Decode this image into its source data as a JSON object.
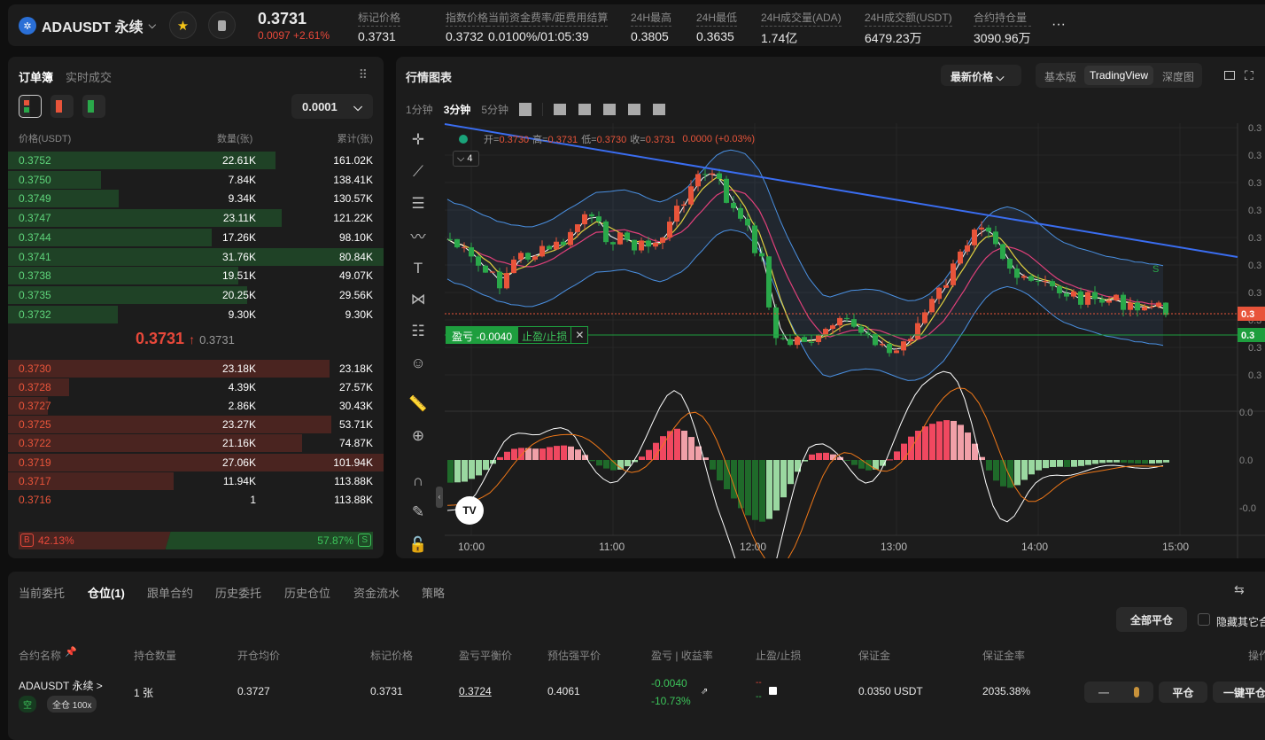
{
  "header": {
    "symbol": "ADAUSDT 永续",
    "coin_icon": "cardano-icon",
    "last_price": "0.3731",
    "change": "0.0097 +2.61%",
    "stats": [
      {
        "label": "标记价格",
        "value": "0.3731"
      },
      {
        "label": "指数价格",
        "value": "0.3732"
      },
      {
        "label": "当前资金费率/距费用结算",
        "value": "0.0100%/01:05:39"
      },
      {
        "label": "24H最高",
        "value": "0.3805"
      },
      {
        "label": "24H最低",
        "value": "0.3635"
      },
      {
        "label": "24H成交量(ADA)",
        "value": "1.74亿"
      },
      {
        "label": "24H成交额(USDT)",
        "value": "6479.23万"
      },
      {
        "label": "合约持仓量",
        "value": "3090.96万"
      }
    ],
    "more": "···"
  },
  "orderbook": {
    "tabs": [
      "订单簿",
      "实时成交"
    ],
    "precision": "0.0001",
    "headers": [
      "价格(USDT)",
      "数量(张)",
      "累计(张)"
    ],
    "top_rows": [
      [
        "0.3752",
        "22.61K",
        "161.02K"
      ],
      [
        "0.3750",
        "7.84K",
        "138.41K"
      ],
      [
        "0.3749",
        "9.34K",
        "130.57K"
      ],
      [
        "0.3747",
        "23.11K",
        "121.22K"
      ],
      [
        "0.3744",
        "17.26K",
        "98.10K"
      ],
      [
        "0.3741",
        "31.76K",
        "80.84K"
      ],
      [
        "0.3738",
        "19.51K",
        "49.07K"
      ],
      [
        "0.3735",
        "20.25K",
        "29.56K"
      ],
      [
        "0.3732",
        "9.30K",
        "9.30K"
      ]
    ],
    "mid_price": "0.3731",
    "mid_arrow": "↑",
    "mark_price": "0.3731",
    "bottom_rows": [
      [
        "0.3730",
        "23.18K",
        "23.18K"
      ],
      [
        "0.3728",
        "4.39K",
        "27.57K"
      ],
      [
        "0.3727",
        "2.86K",
        "30.43K"
      ],
      [
        "0.3725",
        "23.27K",
        "53.71K"
      ],
      [
        "0.3722",
        "21.16K",
        "74.87K"
      ],
      [
        "0.3719",
        "27.06K",
        "101.94K"
      ],
      [
        "0.3717",
        "11.94K",
        "113.88K"
      ],
      [
        "0.3716",
        "1",
        "113.88K"
      ]
    ],
    "buy_label": "B",
    "buy_ratio": "42.13%",
    "sell_ratio": "57.87%",
    "sell_label": "S",
    "buy_fraction": 0.4213
  },
  "chart": {
    "title": "行情图表",
    "price_type": "最新价格",
    "views": [
      "基本版",
      "TradingView",
      "深度图"
    ],
    "active_view": "TradingView",
    "intervals": [
      "1分钟",
      "3分钟",
      "5分钟"
    ],
    "active_interval": "3分钟",
    "ohlc": {
      "o_label": "开=",
      "o": "0.3730",
      "h_label": "高=",
      "h": "0.3731",
      "l_label": "低=",
      "l": "0.3730",
      "c_label": "收=",
      "c": "0.3731",
      "chg": "0.0000 (+0.03%)"
    },
    "indicator_count": "4",
    "pnl_label": "盈亏 -0.0040",
    "tpsl_label": "止盈/止损",
    "close_x": "✕",
    "y_ticks": [
      "0.3",
      "0.3",
      "0.3",
      "0.3",
      "0.3",
      "0.3",
      "0.3",
      "0.3",
      "0.3",
      "0.3"
    ],
    "price_tag": "0.3",
    "position_tag": "0.3",
    "macd_ticks": [
      "0.0",
      "0.0",
      "-0.0"
    ],
    "x_ticks": [
      "10:00",
      "11:00",
      "12:00",
      "13:00",
      "14:00",
      "15:00"
    ],
    "marker": "S",
    "logo": "TV",
    "colors": {
      "up": "#e8543a",
      "down": "#2aa84a",
      "trend": "#3a6df0",
      "band": "#4a90e2"
    }
  },
  "bottom": {
    "tabs": [
      "当前委托",
      "仓位(1)",
      "跟单合约",
      "历史委托",
      "历史仓位",
      "资金流水",
      "策略"
    ],
    "active_tab": "仓位(1)",
    "close_all": "全部平仓",
    "hide_others": "隐藏其它合",
    "columns": [
      "合约名称",
      "持仓数量",
      "开仓均价",
      "标记价格",
      "盈亏平衡价",
      "预估强平价",
      "盈亏 | 收益率",
      "止盈/止损",
      "保证金",
      "保证金率",
      "操作"
    ],
    "row": {
      "symbol": "ADAUSDT 永续 >",
      "side": "空",
      "mode": "全仓 100x",
      "qty": "1 张",
      "entry": "0.3727",
      "mark": "0.3731",
      "breakeven": "0.3724",
      "liq": "0.4061",
      "pnl": "-0.0040",
      "roe": "-10.73%",
      "tp": "--",
      "sl": "--",
      "margin": "0.0350 USDT",
      "margin_rate": "2035.38%",
      "close": "平仓",
      "one_click": "一键平仓"
    }
  }
}
